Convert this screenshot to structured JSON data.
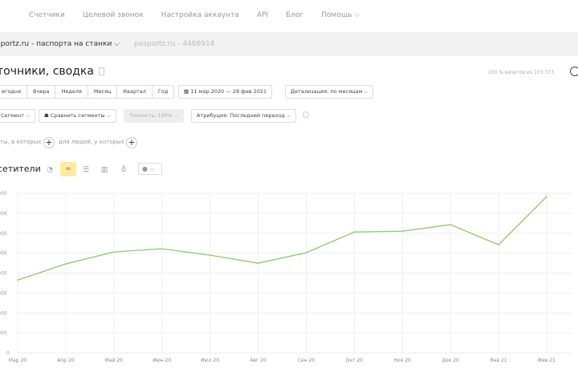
{
  "topnav": [
    "Счетчики",
    "Целевой звонок",
    "Настройка аккаунта",
    "API",
    "Блог",
    "Помощь ⌵"
  ],
  "breadcrumb": {
    "counter": "sportz.ru - паспорта на станки ⌵",
    "id": "pasportz.ru - 4466914"
  },
  "title": "точники, сводка",
  "sample": "100 % визитов из 103 373",
  "periods": [
    "егодня",
    "Вчера",
    "Неделя",
    "Месяц",
    "Квартал",
    "Год"
  ],
  "date_range": "11 мар 2020 — 28 фев 2021",
  "detail": "Детализация: по месяцам ⌵",
  "segment": "Сегмент ⌵",
  "compare": "Сравнить сегменты ⌵",
  "accuracy": "Точность: 100% ⌵",
  "attribution": "Атрибуция: Последний переход ⌵",
  "filter_visits": "ты, в которых",
  "filter_people": "для людей, у которых",
  "metric": "сетители",
  "colors": {
    "line": "#8dc96a",
    "grid": "#eeeeee",
    "active": "#ffeba0"
  },
  "chart_data": {
    "type": "line",
    "categories": [
      "Мар 20",
      "Апр 20",
      "Май 20",
      "Июн 20",
      "Июл 20",
      "Авг 20",
      "Сен 20",
      "Окт 20",
      "Ноя 20",
      "Дек 20",
      "Янв 21",
      "Фев 21"
    ],
    "values": [
      3.65,
      4.46,
      5.06,
      5.22,
      4.9,
      4.5,
      5.02,
      6.06,
      6.1,
      6.43,
      5.42,
      7.83
    ],
    "ylim": [
      0,
      8
    ],
    "yticks": [
      "0",
      "000",
      "000",
      "000",
      "000",
      "000",
      "000",
      "000",
      "000"
    ],
    "grid": true
  }
}
